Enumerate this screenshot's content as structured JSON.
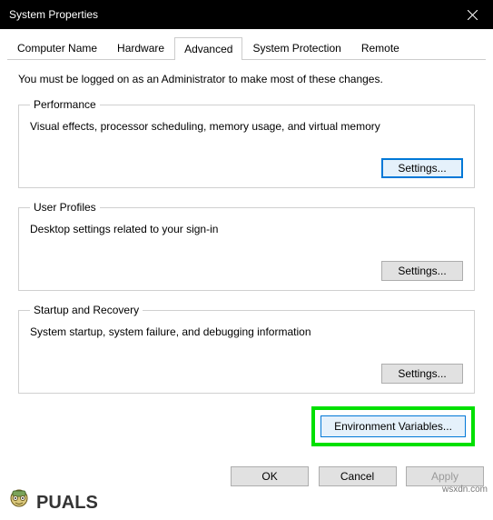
{
  "window": {
    "title": "System Properties"
  },
  "tabs": [
    {
      "label": "Computer Name"
    },
    {
      "label": "Hardware"
    },
    {
      "label": "Advanced"
    },
    {
      "label": "System Protection"
    },
    {
      "label": "Remote"
    }
  ],
  "intro": "You must be logged on as an Administrator to make most of these changes.",
  "groups": {
    "performance": {
      "legend": "Performance",
      "desc": "Visual effects, processor scheduling, memory usage, and virtual memory",
      "button": "Settings..."
    },
    "userprofiles": {
      "legend": "User Profiles",
      "desc": "Desktop settings related to your sign-in",
      "button": "Settings..."
    },
    "startup": {
      "legend": "Startup and Recovery",
      "desc": "System startup, system failure, and debugging information",
      "button": "Settings..."
    }
  },
  "env_button": "Environment Variables...",
  "footer": {
    "ok": "OK",
    "cancel": "Cancel",
    "apply": "Apply"
  },
  "watermark": "wsxdn.com",
  "brand": "PUALS"
}
